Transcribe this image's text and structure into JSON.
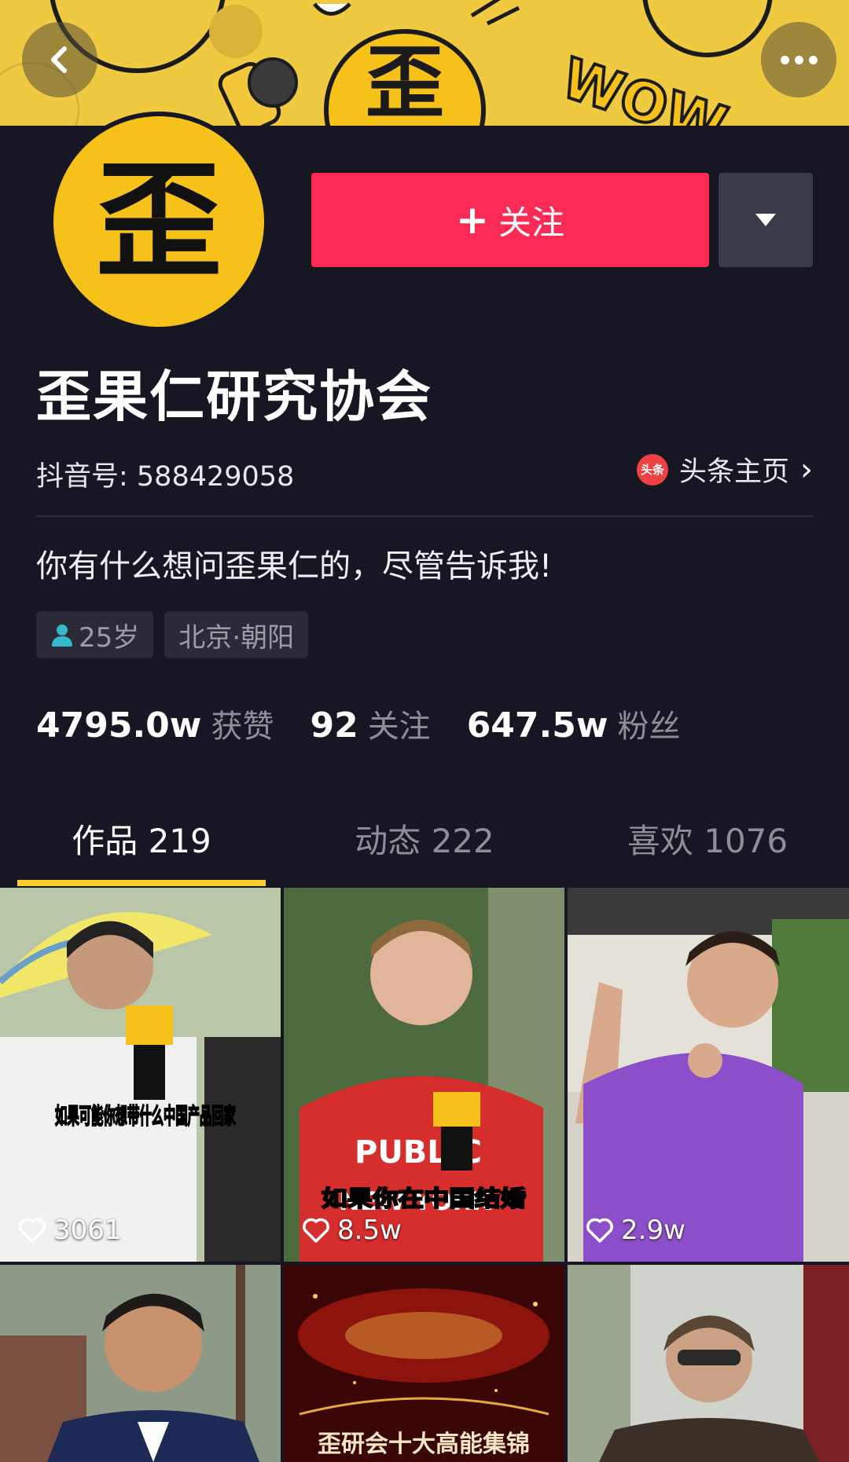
{
  "header": {
    "banner_text": "WOW",
    "banner_badge": "歪"
  },
  "avatar": {
    "char": "歪"
  },
  "actions": {
    "follow_label": "关注",
    "follow_plus": "+"
  },
  "profile": {
    "name": "歪果仁研究协会",
    "douyin_id": "抖音号: 588429058",
    "toutiao_logo": "头条",
    "toutiao_label": "头条主页",
    "bio": "你有什么想问歪果仁的，尽管告诉我!",
    "age": "25岁",
    "location": "北京·朝阳"
  },
  "stats": [
    {
      "value": "4795.0w",
      "label": "获赞"
    },
    {
      "value": "92",
      "label": "关注"
    },
    {
      "value": "647.5w",
      "label": "粉丝"
    }
  ],
  "tabs": [
    {
      "label": "作品 219",
      "active": true
    },
    {
      "label": "动态 222",
      "active": false
    },
    {
      "label": "喜欢 1076",
      "active": false
    }
  ],
  "videos": [
    {
      "likes": "3061",
      "caption": "如果可能你想带什么中国产品回家",
      "bg": "#cfd6c6"
    },
    {
      "likes": "8.5w",
      "caption": "如果你在中国结婚",
      "bg": "#5c7a48"
    },
    {
      "likes": "2.9w",
      "caption": "",
      "bg": "#d9d6cc"
    },
    {
      "likes": "",
      "caption": "",
      "bg": "#8a9a86"
    },
    {
      "likes": "",
      "caption": "歪研会十大高能集锦",
      "bg": "#5b0c0c"
    },
    {
      "likes": "",
      "caption": "",
      "bg": "#c9c8c2"
    }
  ],
  "colors": {
    "accent": "#fc2b55",
    "tab_indicator": "#facd2c",
    "background": "#161722"
  }
}
